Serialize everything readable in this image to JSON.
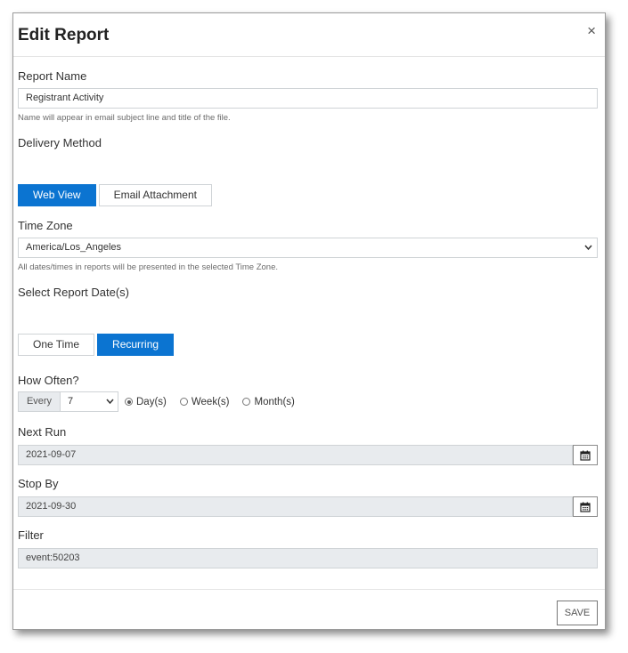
{
  "dialog": {
    "title": "Edit Report",
    "close_glyph": "×"
  },
  "report_name": {
    "label": "Report Name",
    "value": "Registrant Activity",
    "help": "Name will appear in email subject line and title of the file."
  },
  "delivery": {
    "label": "Delivery Method",
    "options": [
      "Web View",
      "Email Attachment"
    ],
    "selected": "Web View"
  },
  "time_zone": {
    "label": "Time Zone",
    "value": "America/Los_Angeles",
    "help": "All dates/times in reports will be presented in the selected Time Zone."
  },
  "report_dates": {
    "label": "Select Report Date(s)",
    "options": [
      "One Time",
      "Recurring"
    ],
    "selected": "Recurring"
  },
  "how_often": {
    "label": "How Often?",
    "every_label": "Every",
    "every_value": "7",
    "units": [
      "Day(s)",
      "Week(s)",
      "Month(s)"
    ],
    "selected_unit": "Day(s)"
  },
  "next_run": {
    "label": "Next Run",
    "value": "2021-09-07"
  },
  "stop_by": {
    "label": "Stop By",
    "value": "2021-09-30"
  },
  "filter": {
    "label": "Filter",
    "value": "event:50203"
  },
  "footer": {
    "save_label": "SAVE"
  },
  "colors": {
    "accent": "#0b74d1",
    "readonly_bg": "#e8ebee"
  }
}
